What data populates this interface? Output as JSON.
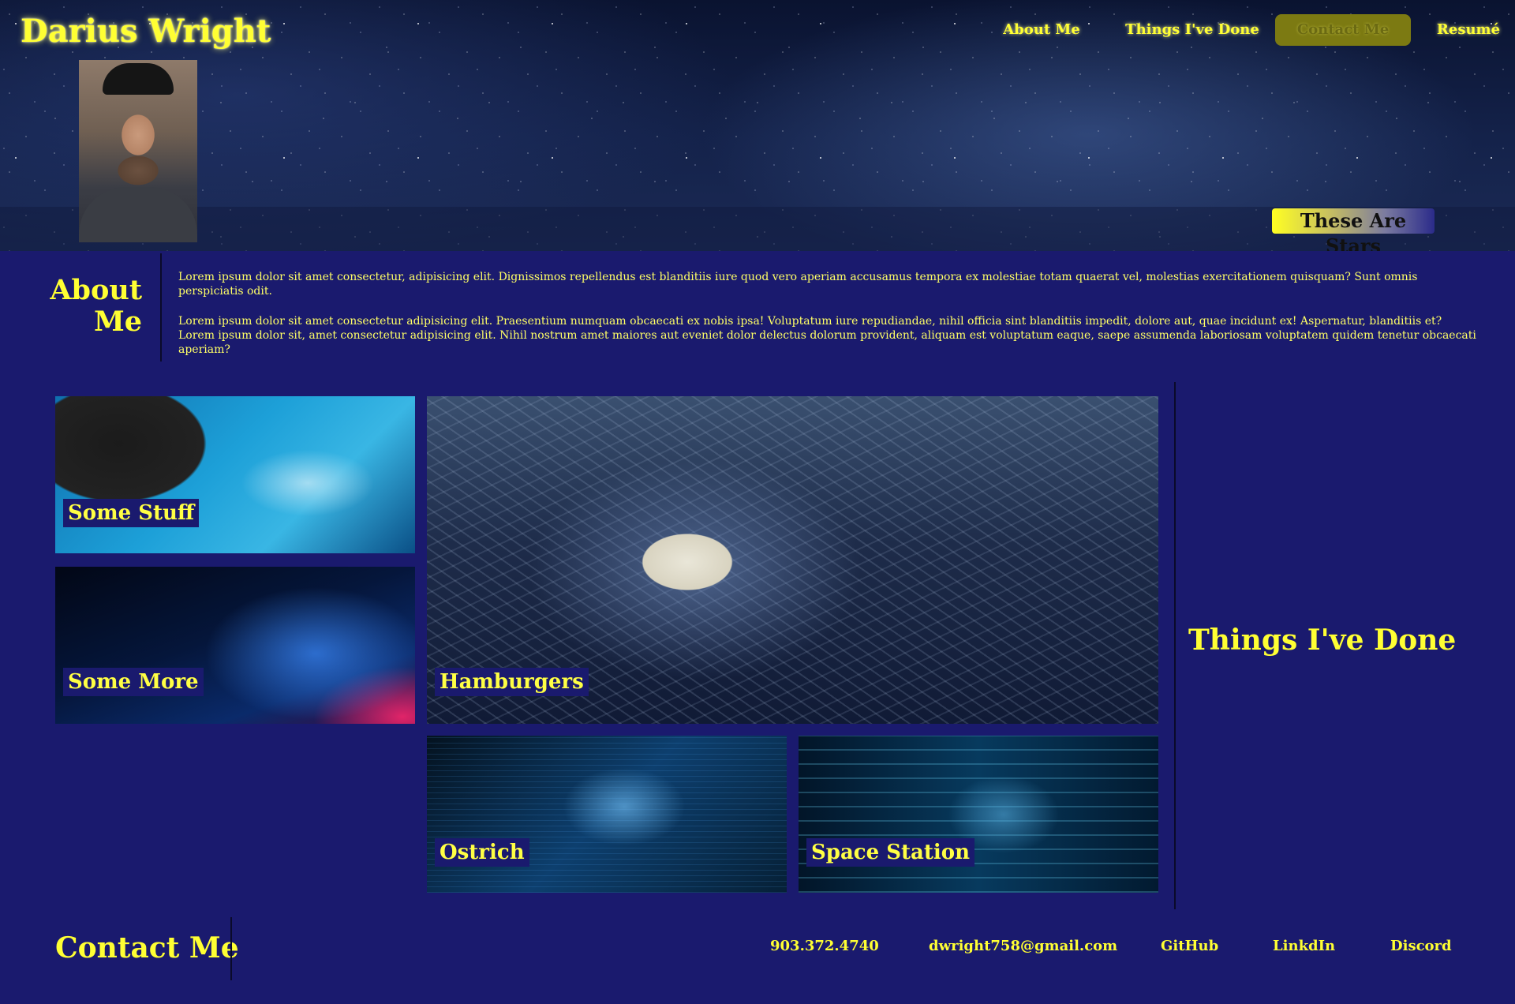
{
  "header": {
    "name": "Darius Wright",
    "nav": {
      "about": "About Me",
      "things": "Things I've Done",
      "contact": "Contact Me",
      "resume": "Resumé"
    },
    "hero_caption": "These Are Stars"
  },
  "about": {
    "heading": "About Me",
    "paragraphs": [
      "Lorem ipsum dolor sit amet consectetur, adipisicing elit. Dignissimos repellendus est blanditiis iure quod vero aperiam accusamus tempora ex molestiae totam quaerat vel, molestias exercitationem quisquam? Sunt omnis perspiciatis odit.",
      "Lorem ipsum dolor sit amet consectetur adipisicing elit. Praesentium numquam obcaecati ex nobis ipsa! Voluptatum iure repudiandae, nihil officia sint blanditiis impedit, dolore aut, quae incidunt ex! Aspernatur, blanditiis et? Lorem ipsum dolor sit, amet consectetur adipisicing elit. Nihil nostrum amet maiores aut eveniet dolor delectus dolorum provident, aliquam est voluptatum eaque, saepe assumenda laboriosam voluptatem quidem tenetur obcaecati aperiam?"
    ]
  },
  "projects": {
    "heading": "Things I've Done",
    "tiles": [
      {
        "label": "Some Stuff"
      },
      {
        "label": "Some More"
      },
      {
        "label": "Hamburgers"
      },
      {
        "label": "Ostrich"
      },
      {
        "label": "Space Station"
      }
    ]
  },
  "contact": {
    "heading": "Contact Me",
    "phone": "903.372.4740",
    "email": "dwright758@gmail.com",
    "github": "GitHub",
    "linkedin": "LinkdIn",
    "discord": "Discord"
  },
  "colors": {
    "background": "#1a1a6e",
    "accent": "#ffff33",
    "nav_active": "#7c7a12"
  }
}
